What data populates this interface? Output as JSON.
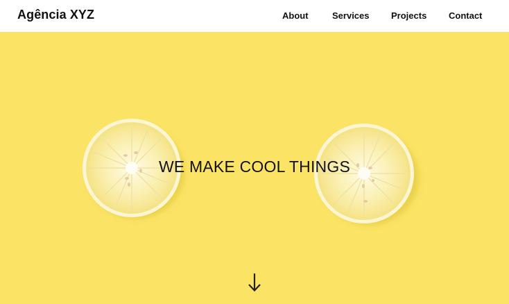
{
  "header": {
    "brand": "Agência XYZ",
    "nav": [
      {
        "label": "About"
      },
      {
        "label": "Services"
      },
      {
        "label": "Projects"
      },
      {
        "label": "Contact"
      }
    ]
  },
  "hero": {
    "headline": "WE MAKE COOL THINGS",
    "background_color": "#fbe365",
    "scroll_icon": "arrow-down-icon"
  }
}
